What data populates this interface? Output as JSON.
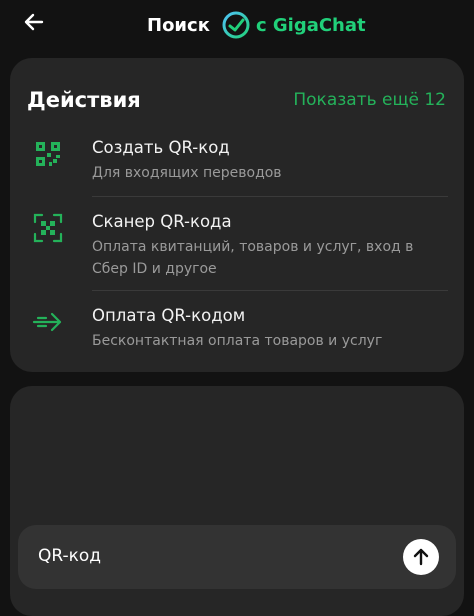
{
  "header": {
    "title": "Поиск",
    "gigachat_label": "с GigaChat",
    "back_icon": "arrow-left-icon",
    "logo_icon": "gigachat-logo-icon"
  },
  "actions": {
    "title": "Действия",
    "show_more": "Показать ещё 12",
    "items": [
      {
        "title": "Создать QR-код",
        "subtitle": "Для входящих переводов",
        "icon": "qr-code-icon"
      },
      {
        "title": "Сканер QR-кода",
        "subtitle": "Оплата квитанций, товаров и услуг, вход в Сбер ID и другое",
        "icon": "qr-scanner-icon"
      },
      {
        "title": "Оплата QR-кодом",
        "subtitle": "Бесконтактная оплата товаров и услуг",
        "icon": "arrow-right-icon"
      }
    ]
  },
  "search": {
    "value": "QR-код",
    "send_icon": "arrow-up-icon"
  },
  "colors": {
    "accent_green": "#24b25a",
    "giga_green": "#21d07a",
    "background": "#121212",
    "card": "#262626"
  }
}
